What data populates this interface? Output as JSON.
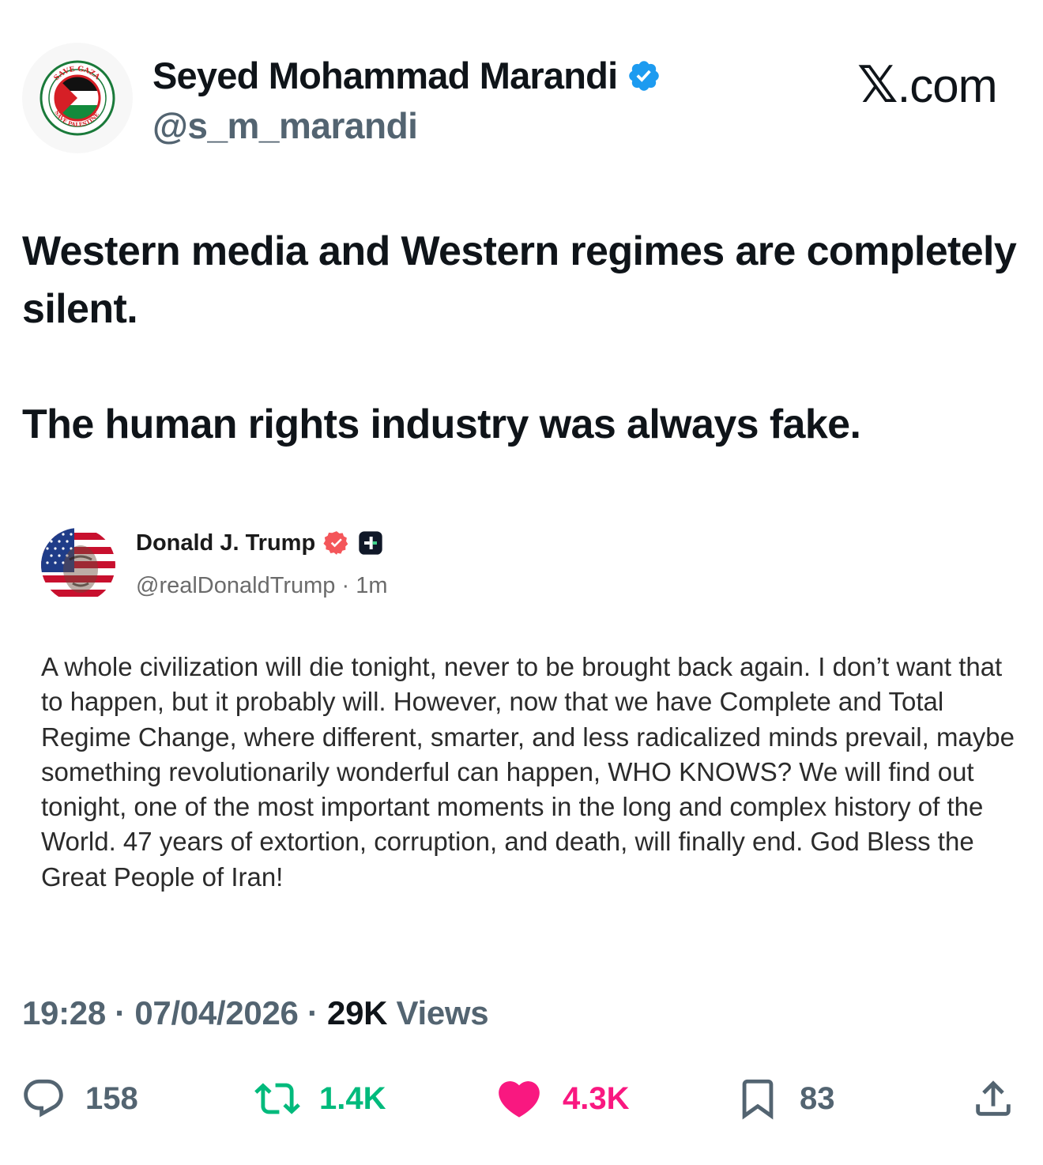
{
  "author": {
    "display_name": "Seyed Mohammad Marandi",
    "handle": "@s_m_marandi",
    "verified": true,
    "avatar_text_top": "SAVE GAZA",
    "avatar_text_bottom": "SAVE PALESTINE"
  },
  "brand": {
    "mark": "𝕏",
    "suffix": ".com"
  },
  "tweet": {
    "paragraphs": [
      "Western media and Western regimes are completely silent.",
      "The human rights industry was always fake."
    ]
  },
  "quoted_post": {
    "display_name": "Donald J. Trump",
    "handle": "@realDonaldTrump",
    "separator": " · ",
    "time": "1m",
    "body": "A whole civilization will die tonight, never to be brought back again. I don’t want that to happen, but it probably will. However, now that we have Complete and Total Regime Change, where different, smarter, and less radicalized minds prevail, maybe something revolutionarily wonderful can happen, WHO KNOWS? We will find out tonight, one of the most important moments in the long and complex history of the World. 47 years of extortion, corruption, and death, will finally end. God Bless the Great People of Iran!"
  },
  "meta": {
    "time": "19:28",
    "sep1": " · ",
    "date": "07/04/2026",
    "sep2": " · ",
    "views_count": "29K",
    "views_label": " Views"
  },
  "actions": {
    "replies": "158",
    "reposts": "1.4K",
    "likes": "4.3K",
    "bookmarks": "83"
  },
  "colors": {
    "text": "#0f1419",
    "secondary": "#536471",
    "verified": "#1d9bf0",
    "repost": "#00ba7c",
    "like": "#f91880",
    "quoted_badge": "#f4565a"
  },
  "icons": {
    "reply": "speech-bubble-icon",
    "repost": "repost-arrows-icon",
    "like": "heart-icon",
    "bookmark": "bookmark-icon",
    "share": "share-upload-icon"
  }
}
